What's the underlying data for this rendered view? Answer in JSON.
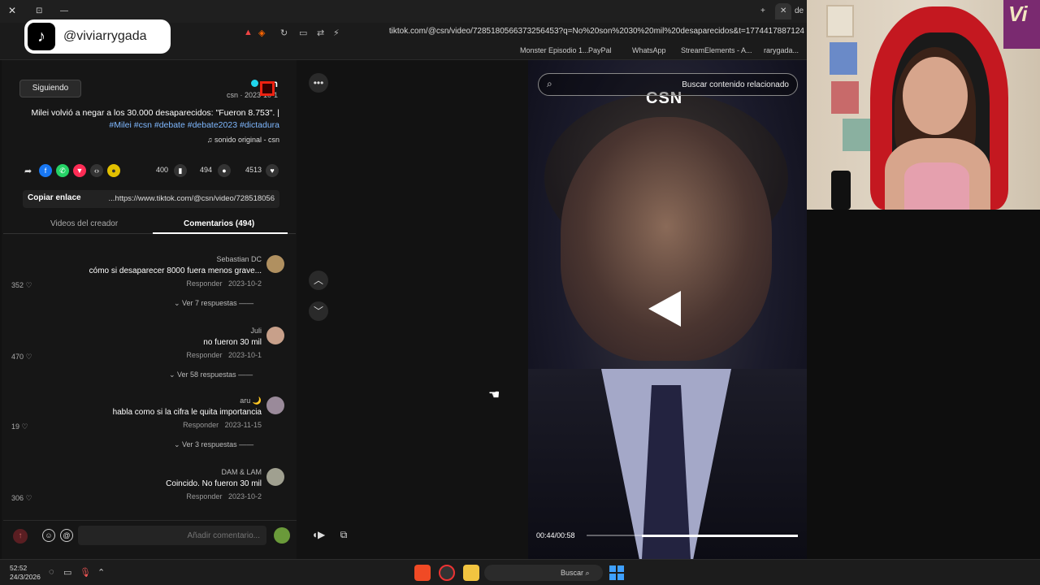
{
  "overlay": {
    "handle": "@viviarrygada",
    "logo": "♪"
  },
  "browser": {
    "tabs": [
      {
        "label": "⊡"
      },
      {
        "label": "—"
      },
      {
        "label": "+"
      },
      {
        "label": "✕"
      },
      {
        "label": "de"
      }
    ],
    "window_close": "✕",
    "url": "tiktok.com/@csn/video/7285180566373256453?q=No%20son%2030%20mil%20desaparecidos&t=1774417887124",
    "bookmarks": [
      "StreamElements - A...",
      "WhatsApp",
      "PayPal",
      "Monster Episodio 1...",
      "rarygada..."
    ]
  },
  "post": {
    "follow_label": "Siguiendo",
    "author_name": "csn",
    "author_sub": "csn · 2023-10-1",
    "description": "Milei volvió a negar a los 30.000 desaparecidos: \"Fueron 8.753\". |",
    "tags": "#Milei #csn #debate #debate2023 #dictadura",
    "sound": "sonido original - csn",
    "likes": "4513",
    "comments_count": "494",
    "saves": "400",
    "link_url": "https://www.tiktok.com/@csn/video/728518056...",
    "copy_label": "Copiar enlace"
  },
  "tabs": {
    "comments": "Comentarios (494)",
    "creator_videos": "Videos del creador"
  },
  "comments": [
    {
      "user": "Sebastian DC",
      "text": "cómo si desaparecer 8000 fuera menos grave...",
      "date": "2023-10-2",
      "reply": "Responder",
      "likes": "352",
      "replies": "Ver 7 respuestas"
    },
    {
      "user": "Juli",
      "text": "no fueron 30 mil",
      "date": "2023-10-1",
      "reply": "Responder",
      "likes": "470",
      "replies": "Ver 58 respuestas"
    },
    {
      "user": "aru 🌙",
      "text": "habla como si la cifra le quita importancia",
      "date": "2023-11-15",
      "reply": "Responder",
      "likes": "19",
      "replies": "Ver 3 respuestas"
    },
    {
      "user": "DAM & LAM",
      "text": "Coincido. No fueron 30 mil",
      "date": "2023-10-2",
      "reply": "Responder",
      "likes": "306",
      "replies": ""
    }
  ],
  "comment_bar": {
    "placeholder": "Añadir comentario..."
  },
  "video": {
    "search_placeholder": "Buscar contenido relacionado",
    "channel_mark": "CSN",
    "time": "00:44/00:58",
    "progress": 0.74
  },
  "taskbar": {
    "time": "52:52",
    "date": "24/3/2026",
    "search": "Buscar"
  },
  "colors": {
    "accent": "#fe2c55",
    "link": "#7fb8ff",
    "verified": "#20d5ec",
    "record": "#e21"
  }
}
